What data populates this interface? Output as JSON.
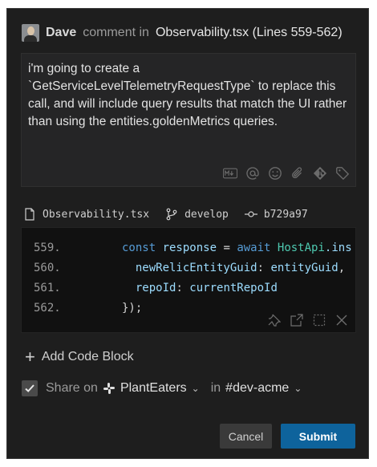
{
  "header": {
    "author": "Dave",
    "action": "comment in",
    "file_ref": "Observability.tsx (Lines 559-562)"
  },
  "comment": {
    "text": "i'm going to create a\n`GetServiceLevelTelemetryRequestType` to replace this call, and will include query results that match the UI rather than using the entities.goldenMetrics queries."
  },
  "toolbar": {
    "icons": [
      "markdown-icon",
      "mention-icon",
      "emoji-icon",
      "attachment-icon",
      "git-icon",
      "tag-icon"
    ],
    "markdown_label": "M↓"
  },
  "meta": {
    "file": "Observability.tsx",
    "branch": "develop",
    "commit": "b729a97"
  },
  "code": {
    "lines": [
      {
        "num": "559.",
        "tokens": [
          {
            "t": "const ",
            "c": "kw"
          },
          {
            "t": "response",
            "c": "va"
          },
          {
            "t": " = ",
            "c": "pl"
          },
          {
            "t": "await ",
            "c": "kw"
          },
          {
            "t": "HostApi",
            "c": "fn"
          },
          {
            "t": ".ins",
            "c": "va"
          }
        ]
      },
      {
        "num": "560.",
        "tokens": [
          {
            "t": "  newRelicEntityGuid",
            "c": "va"
          },
          {
            "t": ": ",
            "c": "pl"
          },
          {
            "t": "entityGuid",
            "c": "va"
          },
          {
            "t": ",",
            "c": "pl"
          }
        ]
      },
      {
        "num": "561.",
        "tokens": [
          {
            "t": "  repoId",
            "c": "va"
          },
          {
            "t": ": ",
            "c": "pl"
          },
          {
            "t": "currentRepoId",
            "c": "va"
          }
        ]
      },
      {
        "num": "562.",
        "tokens": [
          {
            "t": "});",
            "c": "pl"
          }
        ]
      }
    ]
  },
  "add_code_block": {
    "plus": "+",
    "label": "Add Code Block"
  },
  "share": {
    "checked": true,
    "label": "Share on",
    "workspace": "PlantEaters",
    "in_label": "in",
    "channel": "#dev-acme"
  },
  "buttons": {
    "cancel": "Cancel",
    "submit": "Submit"
  },
  "colors": {
    "submit_bg": "#0e639c",
    "keyword": "#569cd6",
    "variable": "#9cdcfe",
    "type": "#4ec9b0"
  }
}
